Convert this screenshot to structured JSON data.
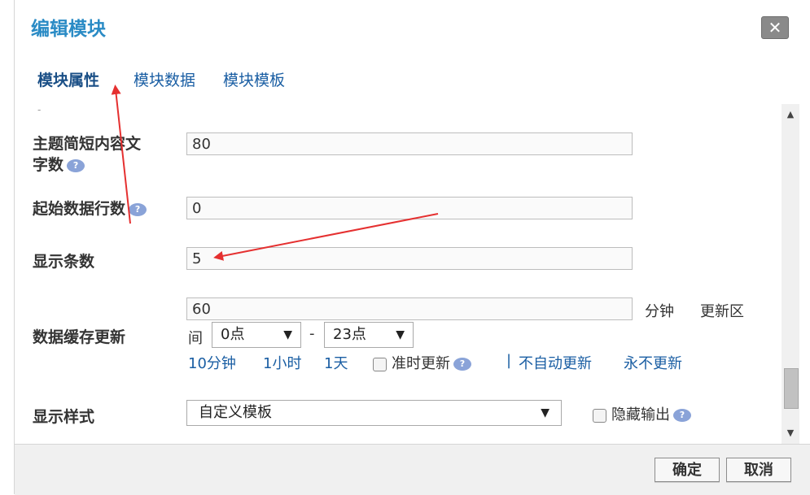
{
  "dialog": {
    "title": "编辑模块",
    "close_label": "✕"
  },
  "tabs": [
    {
      "label": "模块属性",
      "active": true
    },
    {
      "label": "模块数据",
      "active": false
    },
    {
      "label": "模块模板",
      "active": false
    }
  ],
  "fields": {
    "summary_length": {
      "label_line1": "主题简短内容文",
      "label_line2": "字数",
      "value": "80"
    },
    "start_row": {
      "label": "起始数据行数",
      "value": "0"
    },
    "display_count": {
      "label": "显示条数",
      "value": "5"
    },
    "cache_update": {
      "label": "数据缓存更新",
      "value": "60",
      "unit": "分钟",
      "range_label_part1": "更新区",
      "range_label_part2": "间",
      "range_start": "0点",
      "range_separator": "-",
      "range_end": "23点",
      "quick_10min": "10分钟",
      "quick_1hour": "1小时",
      "quick_1day": "1天",
      "ontime_update": "准时更新",
      "pipe": "|",
      "no_auto_update": "不自动更新",
      "never_update": "永不更新"
    },
    "display_style": {
      "label": "显示样式",
      "selected": "自定义模板",
      "hide_output": "隐藏输出"
    }
  },
  "help_icon_glyph": "?",
  "footer": {
    "ok_label": "确定",
    "cancel_label": "取消"
  },
  "colors": {
    "title": "#2a8bc5",
    "link": "#1a5ea3",
    "annotation_arrow": "#e53030"
  }
}
